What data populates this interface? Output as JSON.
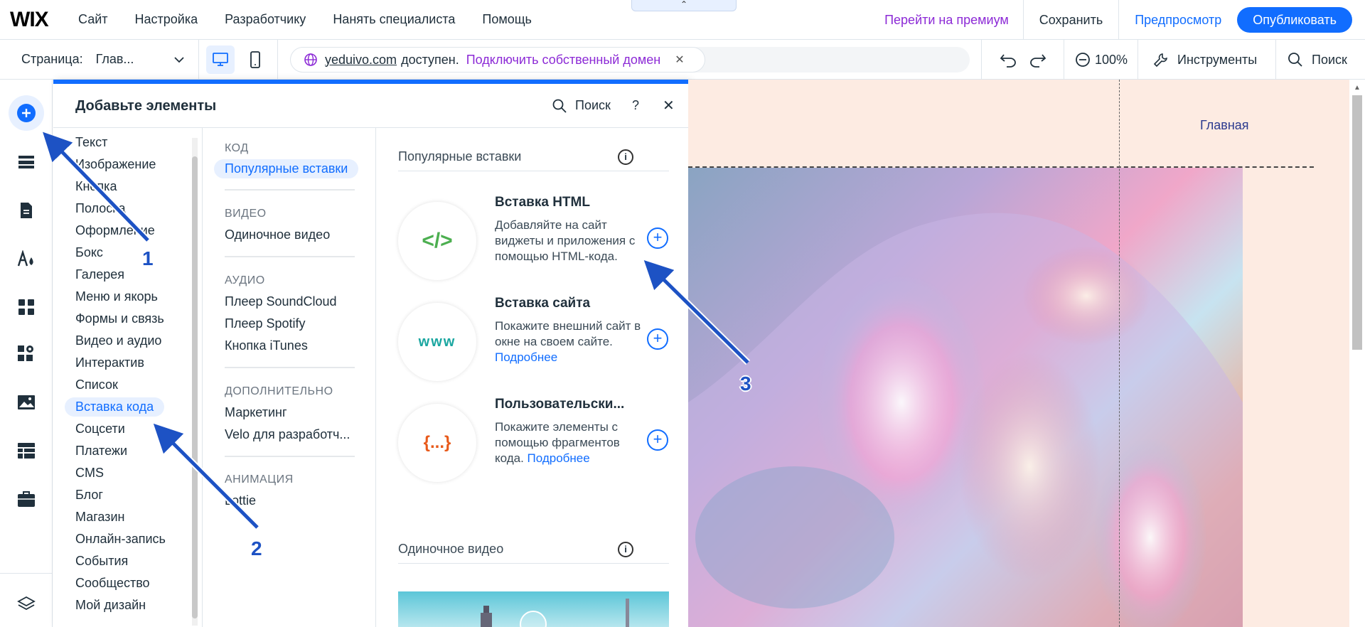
{
  "header": {
    "logo": "WIX",
    "nav": [
      "Сайт",
      "Настройка",
      "Разработчику",
      "Нанять специалиста",
      "Помощь"
    ],
    "collapse_icon": "chevron-up-icon",
    "premium_label": "Перейти на премиум",
    "save_label": "Сохранить",
    "preview_label": "Предпросмотр",
    "publish_label": "Опубликовать"
  },
  "toolbar": {
    "page_label": "Страница:",
    "page_value": "Глав...",
    "domain": "yeduivo.com",
    "domain_status": "доступен.",
    "connect_domain": "Подключить собственный домен",
    "zoom": "100%",
    "tools_label": "Инструменты",
    "search_label": "Поиск"
  },
  "rail": {
    "icons": [
      "add-icon",
      "sections-icon",
      "pages-icon",
      "theme-icon",
      "apps-icon",
      "app-market-icon",
      "media-icon",
      "cms-icon",
      "business-icon",
      "layers-icon"
    ]
  },
  "panel": {
    "title": "Добавьте элементы",
    "search_label": "Поиск",
    "help_label": "?",
    "categories": [
      "Текст",
      "Изображение",
      "Кнопка",
      "Полоска",
      "Оформление",
      "Бокс",
      "Галерея",
      "Меню и якорь",
      "Формы и связь",
      "Видео и аудио",
      "Интерактив",
      "Список",
      "Вставка кода",
      "Соцсети",
      "Платежи",
      "CMS",
      "Блог",
      "Магазин",
      "Онлайн-запись",
      "События",
      "Сообщество",
      "Мой дизайн"
    ],
    "selected_category": "Вставка кода",
    "subsections": [
      {
        "title": "КОД",
        "items": [
          "Популярные вставки"
        ]
      },
      {
        "title": "ВИДЕО",
        "items": [
          "Одиночное видео"
        ]
      },
      {
        "title": "АУДИО",
        "items": [
          "Плеер SoundCloud",
          "Плеер Spotify",
          "Кнопка iTunes"
        ]
      },
      {
        "title": "ДОПОЛНИТЕЛЬНО",
        "items": [
          "Маркетинг",
          "Velo для разработч..."
        ]
      },
      {
        "title": "АНИМАЦИЯ",
        "items": [
          "Lottie"
        ]
      }
    ],
    "popular_title": "Популярные вставки",
    "cards": [
      {
        "icon_text": "</>",
        "title": "Вставка HTML",
        "desc": "Добавляйте на сайт виджеты и приложения с помощью HTML-кода.",
        "link": ""
      },
      {
        "icon_text": "www",
        "title": "Вставка сайта",
        "desc": "Покажите внешний сайт в окне на своем сайте.",
        "link": "Подробнее"
      },
      {
        "icon_text": "{...}",
        "title": "Пользовательски...",
        "desc": "Покажите элементы с помощью фрагментов кода.",
        "link": "Подробнее"
      }
    ],
    "video_title": "Одиночное видео"
  },
  "canvas": {
    "nav_link": "Главная"
  },
  "annotations": [
    "1",
    "2",
    "3"
  ],
  "colors": {
    "accent": "#116dff",
    "premium": "#8c2ad6",
    "arrow": "#1d52c4"
  }
}
